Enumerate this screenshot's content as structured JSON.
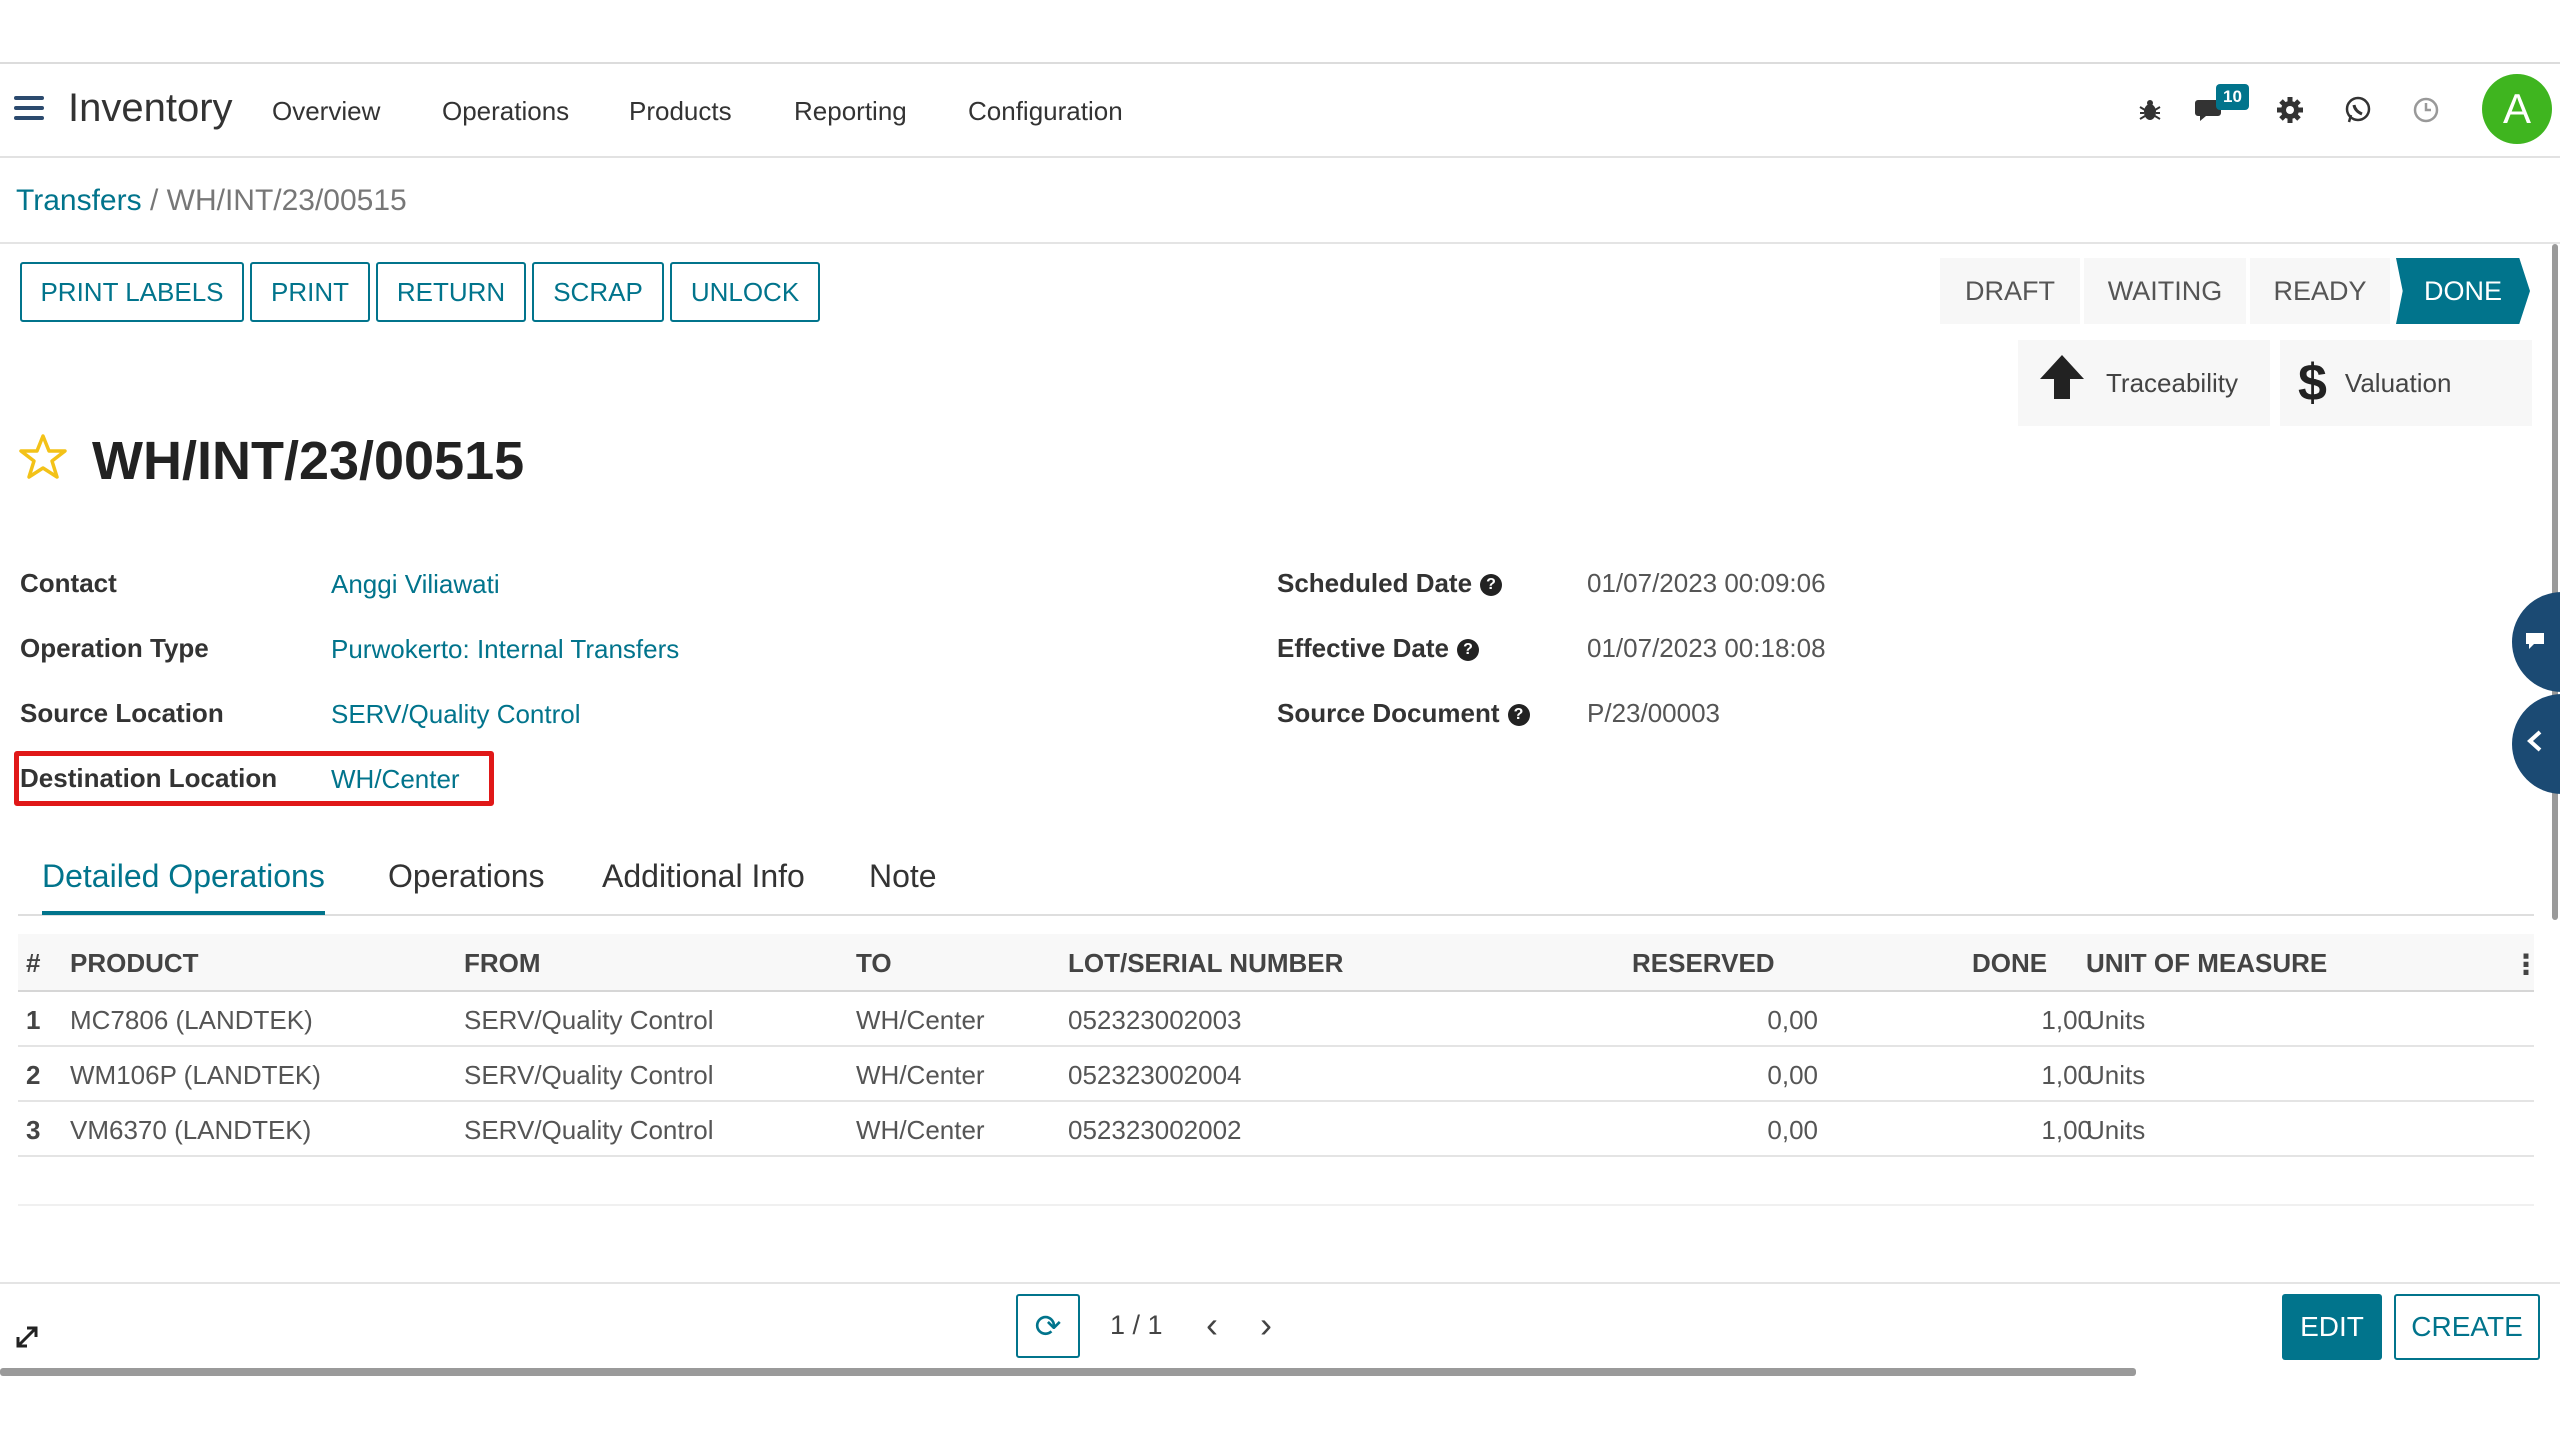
{
  "navbar": {
    "app_name": "Inventory",
    "menu": [
      "Overview",
      "Operations",
      "Products",
      "Reporting",
      "Configuration"
    ],
    "message_count": "10",
    "avatar_letter": "A",
    "icons": [
      "bug-icon",
      "chat-icon",
      "gear-icon",
      "whatsapp-icon",
      "clock-icon"
    ]
  },
  "breadcrumb": {
    "parent": "Transfers",
    "separator": "/",
    "current": "WH/INT/23/00515"
  },
  "actions": [
    "PRINT LABELS",
    "PRINT",
    "RETURN",
    "SCRAP",
    "UNLOCK"
  ],
  "status_stages": [
    "DRAFT",
    "WAITING",
    "READY",
    "DONE"
  ],
  "active_stage": "DONE",
  "smart_buttons": {
    "traceability": "Traceability",
    "valuation": "Valuation"
  },
  "record": {
    "title": "WH/INT/23/00515",
    "fields": {
      "contact_label": "Contact",
      "contact_value": "Anggi Viliawati",
      "operation_type_label": "Operation Type",
      "operation_type_value": "Purwokerto: Internal Transfers",
      "source_location_label": "Source Location",
      "source_location_value": "SERV/Quality Control",
      "destination_location_label": "Destination Location",
      "destination_location_value": "WH/Center",
      "scheduled_date_label": "Scheduled Date",
      "scheduled_date_value": "01/07/2023 00:09:06",
      "effective_date_label": "Effective Date",
      "effective_date_value": "01/07/2023 00:18:08",
      "source_document_label": "Source Document",
      "source_document_value": "P/23/00003"
    }
  },
  "tabs": [
    "Detailed Operations",
    "Operations",
    "Additional Info",
    "Note"
  ],
  "table": {
    "columns": [
      "#",
      "PRODUCT",
      "FROM",
      "TO",
      "LOT/SERIAL NUMBER",
      "RESERVED",
      "DONE",
      "UNIT OF MEASURE"
    ],
    "rows": [
      [
        "1",
        "MC7806 (LANDTEK)",
        "SERV/Quality Control",
        "WH/Center",
        "052323002003",
        "0,00",
        "1,00",
        "Units"
      ],
      [
        "2",
        "WM106P (LANDTEK)",
        "SERV/Quality Control",
        "WH/Center",
        "052323002004",
        "0,00",
        "1,00",
        "Units"
      ],
      [
        "3",
        "VM6370 (LANDTEK)",
        "SERV/Quality Control",
        "WH/Center",
        "052323002002",
        "0,00",
        "1,00",
        "Units"
      ]
    ]
  },
  "footer": {
    "pager": "1 / 1",
    "edit_label": "EDIT",
    "create_label": "CREATE"
  },
  "colors": {
    "accent": "#01748c",
    "highlight": "#e01818",
    "avatar": "#3fb51f",
    "star": "#f3c218"
  }
}
